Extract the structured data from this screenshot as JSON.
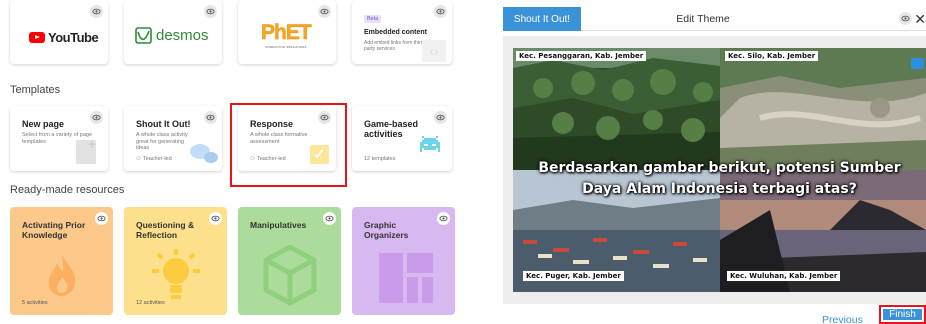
{
  "tools": {
    "youtube_label": "YouTube",
    "desmos_label": "desmos",
    "phet_label": "PhET",
    "phet_sub": "INTERACTIVE SIMULATIONS",
    "embedded": {
      "badge": "Beta",
      "title": "Embedded content",
      "desc": "Add embed links from third-party services"
    }
  },
  "templates": {
    "heading": "Templates",
    "items": [
      {
        "title": "New page",
        "desc": "Select from a variety of page templates",
        "meta": ""
      },
      {
        "title": "Shout It Out!",
        "desc": "A whole class activity great for generating ideas",
        "meta": "Teacher-led"
      },
      {
        "title": "Response",
        "desc": "A whole class formative assessment",
        "meta": "Teacher-led"
      },
      {
        "title": "Game-based activities",
        "desc": "",
        "meta": "12 templates"
      }
    ]
  },
  "resources": {
    "heading": "Ready-made resources",
    "items": [
      {
        "title": "Activating Prior Knowledge",
        "meta": "5 activities",
        "color": "#fcc98a"
      },
      {
        "title": "Questioning & Reflection",
        "meta": "12 activities",
        "color": "#fde08c"
      },
      {
        "title": "Manipulatives",
        "meta": "",
        "color": "#abdc9c"
      },
      {
        "title": "Graphic Organizers",
        "meta": "",
        "color": "#d7b8f0"
      }
    ]
  },
  "editor": {
    "tab_active": "Shout It Out!",
    "tab_edit": "Edit Theme",
    "close_glyph": "✕",
    "slide": {
      "labels": [
        "Kec. Pesanggaran, Kab. Jember",
        "Kec. Silo, Kab. Jember",
        "Kec. Puger, Kab. Jember",
        "Kec. Wuluhan, Kab. Jember"
      ],
      "question_line1": "Berdasarkan gambar berikut, potensi Sumber",
      "question_line2": "Daya Alam Indonesia terbagi atas?"
    },
    "previous_label": "Previous",
    "finish_label": "Finish"
  },
  "highlight_color": "#e8141b",
  "accent_color": "#3a93d8"
}
